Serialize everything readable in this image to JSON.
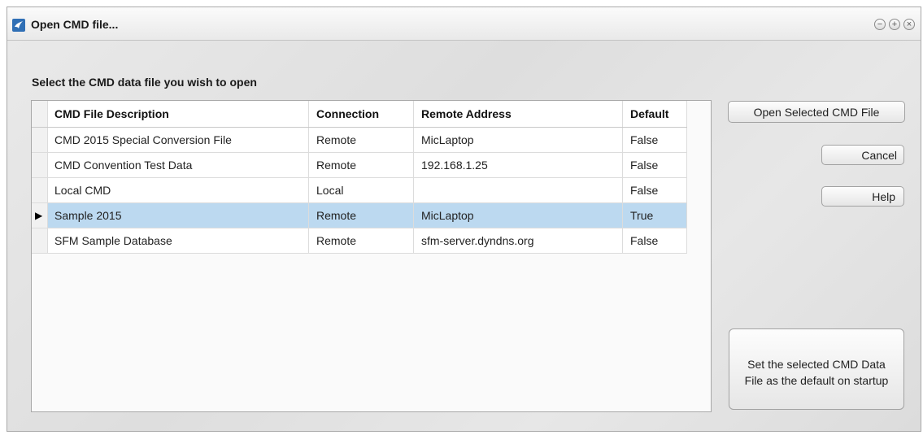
{
  "window": {
    "title": "Open CMD file...",
    "controls": {
      "minimize": "−",
      "maximize": "+",
      "close": "×"
    }
  },
  "dialog": {
    "instruction": "Select the CMD data file you wish to open"
  },
  "grid": {
    "columns": [
      "CMD File Description",
      "Connection",
      "Remote Address",
      "Default"
    ],
    "rows": [
      {
        "indicator": "",
        "description": "CMD 2015 Special Conversion File",
        "connection": "Remote",
        "address": "MicLaptop",
        "default": "False"
      },
      {
        "indicator": "",
        "description": "CMD Convention Test Data",
        "connection": "Remote",
        "address": "192.168.1.25",
        "default": "False"
      },
      {
        "indicator": "",
        "description": "Local CMD",
        "connection": "Local",
        "address": "",
        "default": "False"
      },
      {
        "indicator": "▶",
        "description": "Sample 2015",
        "connection": "Remote",
        "address": "MicLaptop",
        "default": "True"
      },
      {
        "indicator": "",
        "description": "SFM Sample Database",
        "connection": "Remote",
        "address": "sfm-server.dyndns.org",
        "default": "False"
      }
    ],
    "selected_row": 3
  },
  "buttons": {
    "open": "Open Selected CMD File",
    "cancel": "Cancel",
    "help": "Help",
    "set_default_line1": "Set the selected CMD Data",
    "set_default_line2": "File as the default on startup"
  },
  "colors": {
    "selected_row": "#bcd9f0",
    "app_icon": "#2f6fb5"
  },
  "icons": {
    "app": "bird-logo-icon",
    "row_indicator": "triangle-right-icon"
  }
}
